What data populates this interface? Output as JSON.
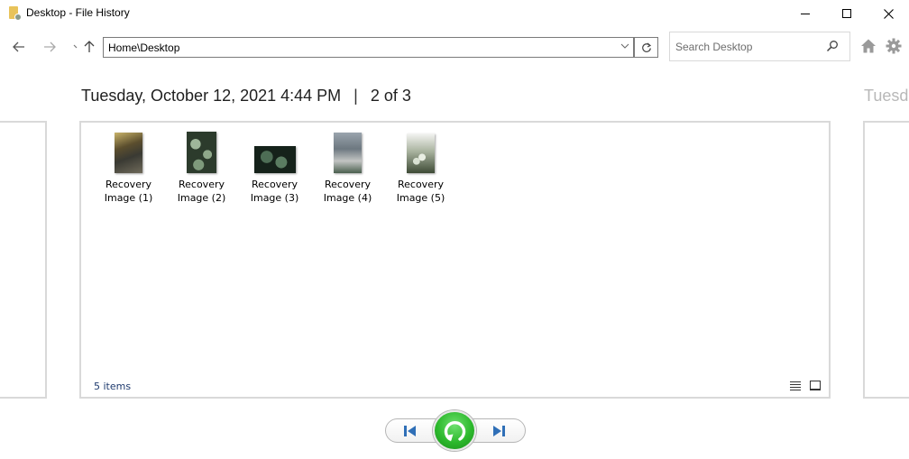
{
  "window": {
    "title": "Desktop - File History",
    "controls": {
      "minimize": "minimize",
      "maximize": "maximize",
      "close": "close"
    }
  },
  "nav": {
    "back_icon": "arrow-left-icon",
    "forward_icon": "arrow-right-icon",
    "recent_icon": "recent-locations-icon",
    "up_icon": "arrow-up-icon",
    "address": "Home\\Desktop",
    "refresh_icon": "refresh-icon",
    "search_placeholder": "Search Desktop",
    "home_icon": "home-icon",
    "settings_icon": "gear-icon"
  },
  "snapshot": {
    "datetime": "Tuesday, October 12, 2021 4:44 PM",
    "separator": "|",
    "position": "2 of 3",
    "next_preview_text": "Tuesda"
  },
  "files": [
    {
      "line1": "Recovery",
      "line2": "Image (1)"
    },
    {
      "line1": "Recovery",
      "line2": "Image (2)"
    },
    {
      "line1": "Recovery",
      "line2": "Image (3)"
    },
    {
      "line1": "Recovery",
      "line2": "Image (4)"
    },
    {
      "line1": "Recovery",
      "line2": "Image (5)"
    }
  ],
  "status": {
    "item_count": "5 items"
  },
  "controls": {
    "previous": "Previous version",
    "restore": "Restore to original location",
    "next": "Next version"
  },
  "colors": {
    "restore_green": "#2db92d",
    "nav_blue": "#2f6fb7",
    "status_text": "#1e3a6e"
  }
}
